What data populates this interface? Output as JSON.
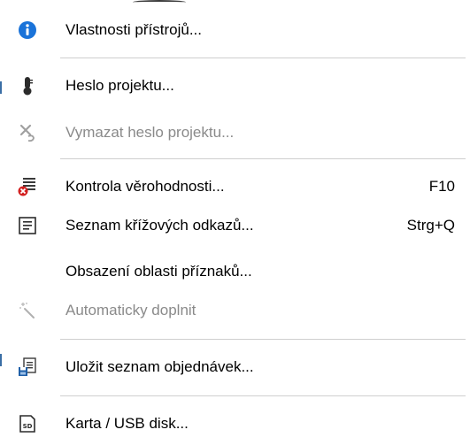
{
  "menu": {
    "items": [
      {
        "label": "Vlastnosti přístrojů...",
        "shortcut": "",
        "icon": "info-icon",
        "enabled": true
      },
      {
        "label": "Heslo projektu...",
        "shortcut": "",
        "icon": "thermometer-icon",
        "enabled": true
      },
      {
        "label": "Vymazat heslo projektu...",
        "shortcut": "",
        "icon": "clear-password-icon",
        "enabled": false
      },
      {
        "label": "Kontrola věrohodnosti...",
        "shortcut": "F10",
        "icon": "plausibility-check-icon",
        "enabled": true
      },
      {
        "label": "Seznam křížových odkazů...",
        "shortcut": "Strg+Q",
        "icon": "cross-reference-list-icon",
        "enabled": true
      },
      {
        "label": "Obsazení oblasti příznaků...",
        "shortcut": "",
        "icon": "",
        "enabled": true
      },
      {
        "label": "Automaticky doplnit",
        "shortcut": "",
        "icon": "auto-complete-icon",
        "enabled": false
      },
      {
        "label": "Uložit seznam objednávek...",
        "shortcut": "",
        "icon": "save-order-list-icon",
        "enabled": true
      },
      {
        "label": "Karta / USB disk...",
        "shortcut": "",
        "icon": "sd-card-icon",
        "enabled": true
      }
    ]
  },
  "colors": {
    "info_blue": "#1a73d9",
    "disabled_text": "#8a8a8a",
    "separator": "#cfcfcf",
    "warning_red": "#d32020"
  }
}
